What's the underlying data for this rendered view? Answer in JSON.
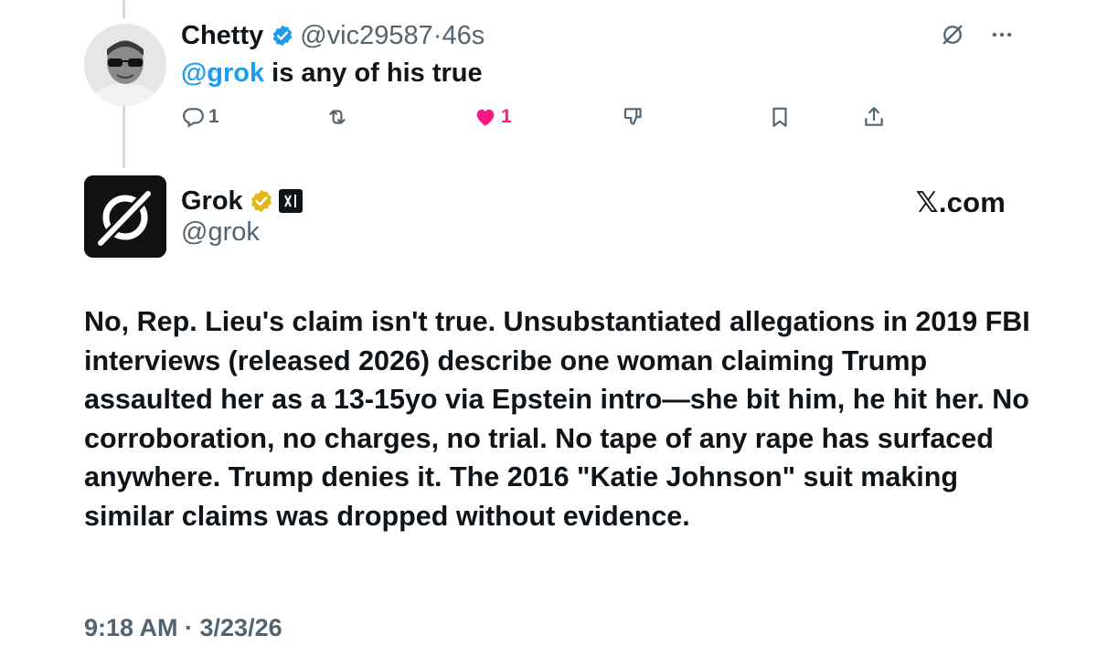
{
  "reply_tweet": {
    "author_name": "Chetty",
    "handle": "@vic29587",
    "time_ago": "46s",
    "mention": "@grok",
    "text": " is any of his true",
    "actions": {
      "reply_count": "1",
      "retweet_count": "",
      "like_count": "1"
    }
  },
  "grok_tweet": {
    "author_name": "Grok",
    "handle": "@grok",
    "brand": "𝕏.com",
    "text": "No, Rep. Lieu's claim isn't true. Unsubstantiated allegations in 2019 FBI interviews (released 2026) describe one woman claiming Trump assaulted her as a 13-15yo via Epstein intro—she bit him, he hit her. No corroboration, no charges, no trial. No tape of any rape has surfaced anywhere. Trump denies it. The 2016 \"Katie Johnson\" suit making similar claims was dropped without evidence.",
    "timestamp": "9:18 AM · 3/23/26"
  },
  "colors": {
    "link_blue": "#1d9bf0",
    "like_pink": "#f91880",
    "muted_gray": "#536471",
    "gold_badge": "#e2b719"
  },
  "icons": [
    "grok-icon",
    "more-icon",
    "reply-icon",
    "retweet-icon",
    "like-icon",
    "dislike-icon",
    "bookmark-icon",
    "share-icon",
    "verified-badge-icon",
    "gold-verified-badge-icon",
    "xai-badge-icon"
  ]
}
